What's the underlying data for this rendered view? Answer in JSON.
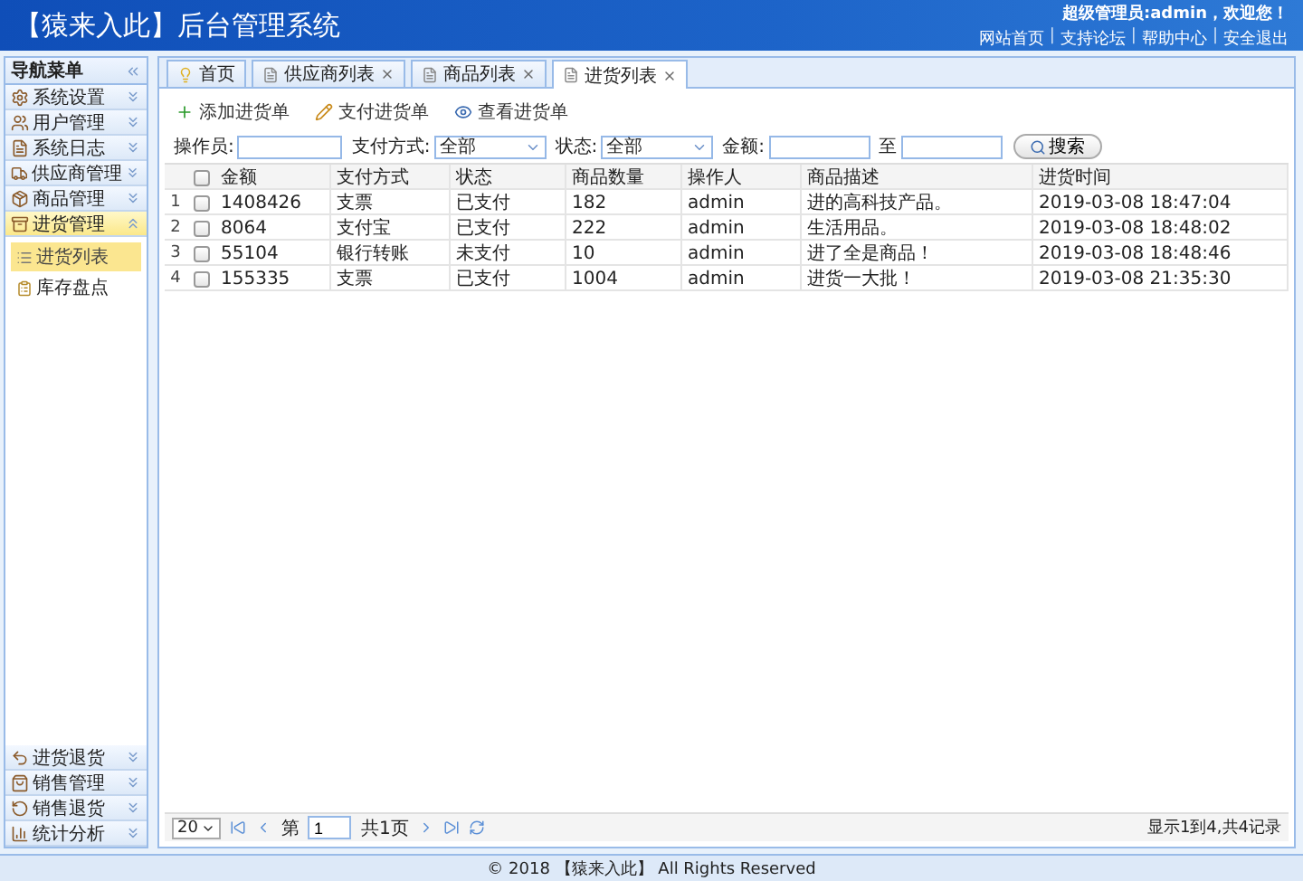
{
  "header": {
    "title": "【猿来入此】后台管理系统",
    "welcome": "超级管理员:admin，欢迎您！",
    "links": [
      {
        "kind": "link",
        "text": "网站首页"
      },
      {
        "kind": "separator",
        "text": "|"
      },
      {
        "kind": "link",
        "text": "支持论坛"
      },
      {
        "kind": "separator",
        "text": "|"
      },
      {
        "kind": "link",
        "text": "帮助中心"
      },
      {
        "kind": "separator",
        "text": "|"
      },
      {
        "kind": "link",
        "text": "安全退出"
      }
    ]
  },
  "nav": {
    "title": "导航菜单",
    "items": [
      {
        "label": "系统设置",
        "expanded": false
      },
      {
        "label": "用户管理",
        "expanded": false
      },
      {
        "label": "系统日志",
        "expanded": false
      },
      {
        "label": "供应商管理",
        "expanded": false
      },
      {
        "label": "商品管理",
        "expanded": false
      },
      {
        "label": "进货管理",
        "expanded": true,
        "children": [
          {
            "label": "进货列表",
            "selected": true
          },
          {
            "label": "库存盘点",
            "selected": false
          }
        ]
      },
      {
        "label": "进货退货",
        "expanded": false
      },
      {
        "label": "销售管理",
        "expanded": false
      },
      {
        "label": "销售退货",
        "expanded": false
      },
      {
        "label": "统计分析",
        "expanded": false
      }
    ]
  },
  "tabs": [
    {
      "label": "首页",
      "selected": false,
      "closable": false
    },
    {
      "label": "供应商列表",
      "selected": false,
      "closable": true
    },
    {
      "label": "商品列表",
      "selected": false,
      "closable": true
    },
    {
      "label": "进货列表",
      "selected": true,
      "closable": true
    }
  ],
  "toolbar": [
    {
      "label": "添加进货单",
      "kind": "add"
    },
    {
      "label": "支付进货单",
      "kind": "pay"
    },
    {
      "label": "查看进货单",
      "kind": "view"
    }
  ],
  "filters": {
    "operator_label": "操作员:",
    "payment_label": "支付方式:",
    "payment_value": "全部",
    "status_label": "状态:",
    "status_value": "全部",
    "amount_label": "金额:",
    "to_label": "至",
    "search_button": "搜索"
  },
  "table": {
    "select_all_checked": false,
    "columns": [
      "金额",
      "支付方式",
      "状态",
      "商品数量",
      "操作人",
      "商品描述",
      "进货时间"
    ],
    "rows": [
      {
        "number": "1",
        "checked": false,
        "cells": [
          "1408426",
          "支票",
          "已支付",
          "182",
          "admin",
          "进的高科技产品。",
          "2019-03-08 18:47:04"
        ]
      },
      {
        "number": "2",
        "checked": false,
        "cells": [
          "8064",
          "支付宝",
          "已支付",
          "222",
          "admin",
          "生活用品。",
          "2019-03-08 18:48:02"
        ]
      },
      {
        "number": "3",
        "checked": false,
        "cells": [
          "55104",
          "银行转账",
          "未支付",
          "10",
          "admin",
          "进了全是商品！",
          "2019-03-08 18:48:46"
        ]
      },
      {
        "number": "4",
        "checked": false,
        "cells": [
          "155335",
          "支票",
          "已支付",
          "1004",
          "admin",
          "进货一大批！",
          "2019-03-08 21:35:30"
        ]
      }
    ]
  },
  "pagination": {
    "page_size": "20",
    "page_prefix": "第",
    "page": "1",
    "page_total": "共1页",
    "summary": "显示1到4,共4记录"
  },
  "footer": "© 2018 【猿来入此】 All Rights Reserved"
}
